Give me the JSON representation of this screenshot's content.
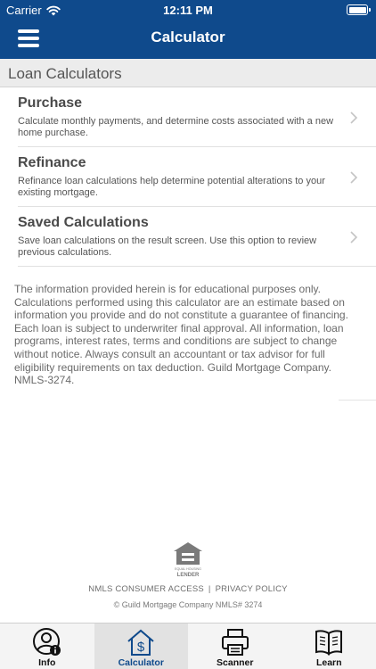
{
  "status_bar": {
    "carrier": "Carrier",
    "time": "12:11 PM"
  },
  "navbar": {
    "title": "Calculator",
    "menu_icon": "hamburger-menu-icon"
  },
  "section": {
    "title": "Loan Calculators"
  },
  "calculators": [
    {
      "title": "Purchase",
      "description": "Calculate monthly payments, and determine costs associated with a new home purchase."
    },
    {
      "title": "Refinance",
      "description": "Refinance loan calculations help determine potential alterations to your existing mortgage."
    },
    {
      "title": "Saved Calculations",
      "description": "Save loan calculations on the result screen. Use this option to review previous calculations."
    }
  ],
  "disclaimer": "The information provided herein is for educational purposes only. Calculations performed using this calculator are an estimate based on information you provide and do not constitute a guarantee of financing. Each loan is subject to underwriter final approval. All information, loan programs, interest rates, terms and conditions are subject to change without notice. Always consult an accountant or tax advisor for full eligibility requirements on tax deduction.  Guild Mortgage Company.  NMLS-3274.",
  "footer": {
    "logo_text": "EQUAL HOUSING LENDER",
    "nmls_link": "NMLS CONSUMER ACCESS",
    "separator": "|",
    "privacy_link": "PRIVACY POLICY",
    "copyright": "© Guild Mortgage Company NMLS# 3274"
  },
  "tabs": [
    {
      "label": "Info",
      "icon": "person-info-icon",
      "active": false
    },
    {
      "label": "Calculator",
      "icon": "house-dollar-icon",
      "active": true
    },
    {
      "label": "Scanner",
      "icon": "printer-scanner-icon",
      "active": false
    },
    {
      "label": "Learn",
      "icon": "open-book-icon",
      "active": false
    }
  ],
  "colors": {
    "brand": "#0f4a8c",
    "section_bg": "#ececec",
    "tabbar_bg": "#f4f4f4"
  }
}
